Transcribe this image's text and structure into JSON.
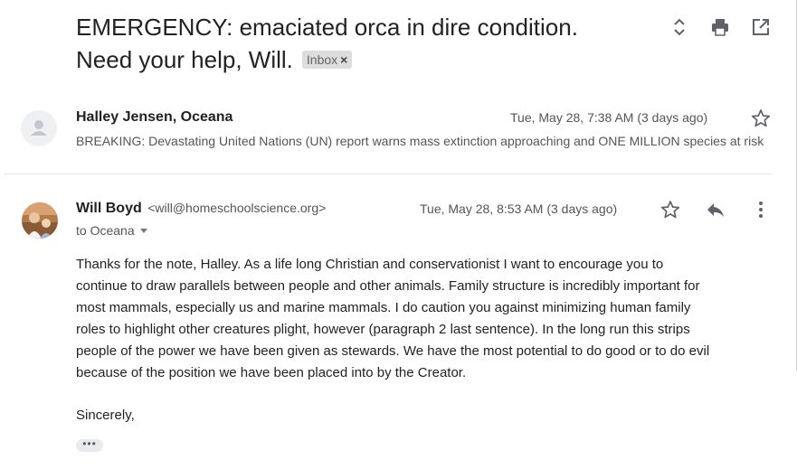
{
  "subject": {
    "line1": "EMERGENCY: emaciated orca in dire condition.",
    "line2": "Need your help, Will.",
    "label": "Inbox",
    "label_remove": "×"
  },
  "toolbar": {
    "icons": [
      "expand-all-icon",
      "print-icon",
      "open-in-new-window-icon"
    ]
  },
  "message1": {
    "sender": "Halley Jensen, Oceana",
    "date": "Tue, May 28, 7:38 AM (3 days ago)",
    "snippet": "BREAKING: Devastating United Nations (UN) report warns mass extinction approaching and ONE MILLION species at risk"
  },
  "message2": {
    "sender": "Will Boyd",
    "email": "<will@homeschoolscience.org>",
    "date": "Tue, May 28, 8:53 AM (3 days ago)",
    "to": "to Oceana",
    "body": [
      "Thanks for the note, Halley. As a life long Christian and conservationist I want to encourage you to",
      "continue to draw parallels between people and other animals. Family structure is incredibly important for",
      "most mammals, especially us and marine mammals. I do caution you against minimizing human family",
      "roles to highlight other creatures plight, however (paragraph 2 last sentence). In the long run this strips",
      "people of the power we have been given as stewards. We have the most potential to do good or to do evil",
      "because of the position we have been placed into by the Creator."
    ],
    "signoff": "Sincerely,",
    "more_label": "•••"
  },
  "colors": {
    "text": "#222222",
    "muted": "#555555",
    "icon": "#5f6368",
    "badge_bg": "#dddddd"
  }
}
